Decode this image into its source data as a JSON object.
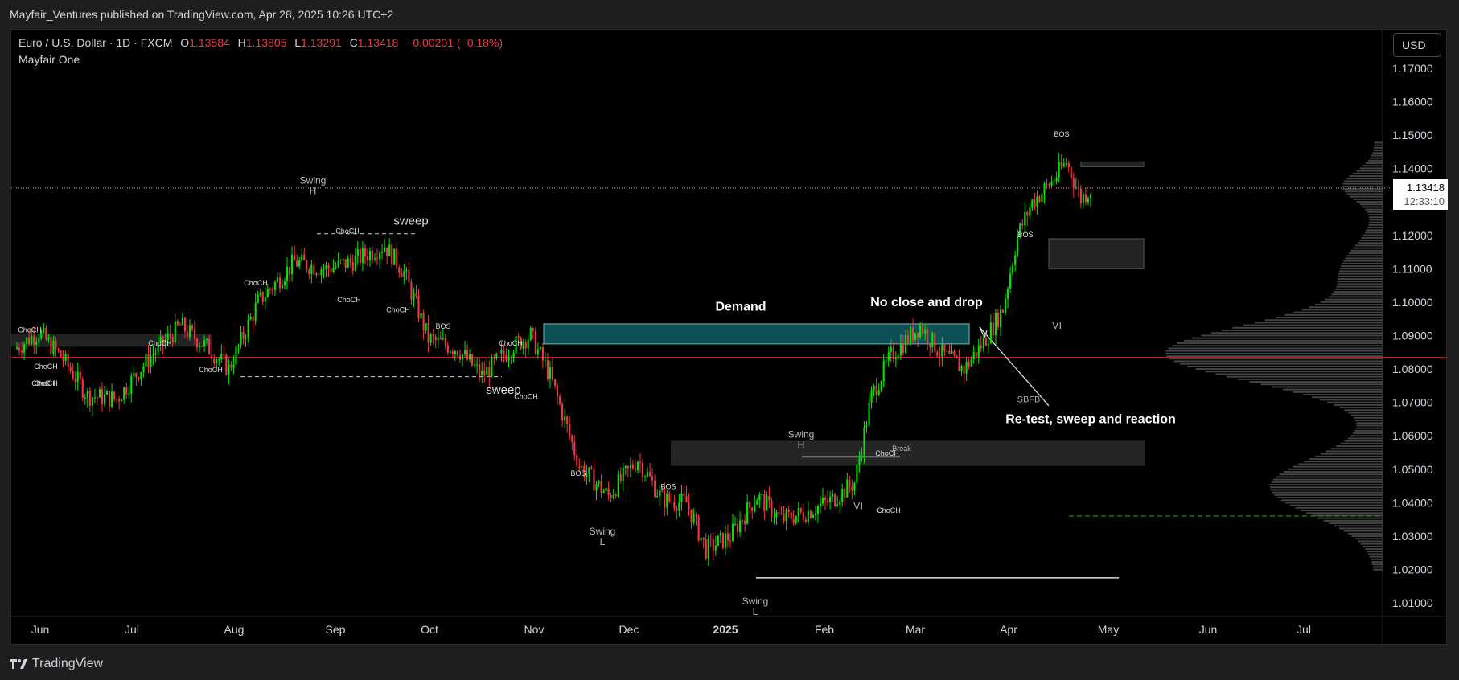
{
  "publisher": "Mayfair_Ventures published on TradingView.com, Apr 28, 2025 10:26 UTC+2",
  "header": {
    "symbol": "Euro / U.S. Dollar · 1D · FXCM",
    "o_label": "O",
    "o": "1.13584",
    "h_label": "H",
    "h": "1.13805",
    "l_label": "L",
    "l": "1.13291",
    "c_label": "C",
    "c": "1.13418",
    "change": "−0.00201 (−0.18%)",
    "indicator": "Mayfair One"
  },
  "currency_button": "USD",
  "last_price": "1.13418",
  "countdown": "12:33:10",
  "footer_brand": "TradingView",
  "colors": {
    "up": "#00e600",
    "down": "#f23645",
    "demand": "#0f5e66",
    "text": "#d1d4dc"
  },
  "chart_data": {
    "type": "candlestick",
    "y_ticks": [
      "1.17000",
      "1.16000",
      "1.15000",
      "1.14000",
      "1.13000",
      "1.12000",
      "1.11000",
      "1.10000",
      "1.09000",
      "1.08000",
      "1.07000",
      "1.06000",
      "1.05000",
      "1.04000",
      "1.03000",
      "1.02000",
      "1.01000"
    ],
    "ylim": [
      1.005,
      1.178
    ],
    "x_ticks": [
      "Jun",
      "Jul",
      "Aug",
      "Sep",
      "Oct",
      "Nov",
      "Dec",
      "2025",
      "Feb",
      "Mar",
      "Apr",
      "May",
      "Jun",
      "Jul"
    ],
    "close_path": [
      [
        0,
        1.086
      ],
      [
        10,
        1.091
      ],
      [
        20,
        1.083
      ],
      [
        30,
        1.072
      ],
      [
        42,
        1.071
      ],
      [
        55,
        1.083
      ],
      [
        68,
        1.093
      ],
      [
        80,
        1.086
      ],
      [
        88,
        1.08
      ],
      [
        100,
        1.1
      ],
      [
        115,
        1.112
      ],
      [
        128,
        1.11
      ],
      [
        138,
        1.112
      ],
      [
        152,
        1.117
      ],
      [
        160,
        1.109
      ],
      [
        170,
        1.089
      ],
      [
        182,
        1.086
      ],
      [
        192,
        1.078
      ],
      [
        205,
        1.087
      ],
      [
        212,
        1.09
      ],
      [
        220,
        1.078
      ],
      [
        232,
        1.051
      ],
      [
        244,
        1.042
      ],
      [
        256,
        1.053
      ],
      [
        266,
        1.041
      ],
      [
        276,
        1.04
      ],
      [
        284,
        1.026
      ],
      [
        294,
        1.03
      ],
      [
        305,
        1.042
      ],
      [
        315,
        1.035
      ],
      [
        325,
        1.037
      ],
      [
        336,
        1.041
      ],
      [
        345,
        1.046
      ],
      [
        352,
        1.072
      ],
      [
        360,
        1.084
      ],
      [
        372,
        1.093
      ],
      [
        380,
        1.085
      ],
      [
        390,
        1.08
      ],
      [
        398,
        1.088
      ],
      [
        406,
        1.098
      ],
      [
        412,
        1.12
      ],
      [
        418,
        1.13
      ],
      [
        426,
        1.136
      ],
      [
        432,
        1.142
      ],
      [
        438,
        1.131
      ],
      [
        442,
        1.134
      ]
    ],
    "annotations": {
      "swing_h": "Swing\nH",
      "swing_l": "Swing\nL",
      "sweep": "sweep",
      "choch": "ChoCH",
      "bos": "BOS",
      "vi": "VI",
      "sbfb": "SBFB",
      "break": "Break",
      "demand": "Demand",
      "no_close_and_drop": "No close and drop",
      "retest": "Re-test, sweep and reaction"
    }
  }
}
